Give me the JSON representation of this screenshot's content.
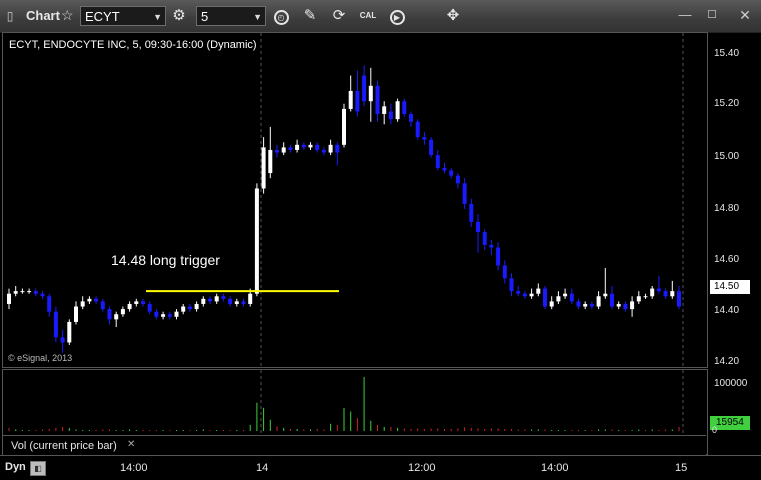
{
  "toolbar": {
    "app_title": "Chart",
    "symbol": "ECYT",
    "interval": "5",
    "calendar_icon_text": "CAL"
  },
  "chart": {
    "title": "ECYT, ENDOCYTE INC, 5, 09:30-16:00 (Dynamic)",
    "annotation": "14.48 long trigger",
    "copyright": "© eSignal, 2013",
    "last_price_label": "14.50",
    "colors": {
      "up": "#ffffff",
      "down": "#1a1aff",
      "trigger": "#ffff00",
      "vol_up": "#3fcf3f",
      "vol_down": "#cc2222"
    }
  },
  "price_axis": {
    "ticks": [
      "15.40",
      "15.20",
      "15.00",
      "14.80",
      "14.60",
      "14.40",
      "14.20"
    ]
  },
  "volume": {
    "label": "Vol (current price bar)",
    "tick": "100000",
    "zero": "0",
    "last_value": "15954"
  },
  "time_axis": {
    "labels": [
      "14:00",
      "14",
      "12:00",
      "14:00",
      "15"
    ],
    "mode": "Dyn"
  },
  "chart_data": {
    "type": "candlestick",
    "title": "ECYT, ENDOCYTE INC, 5, 09:30-16:00 (Dynamic)",
    "y_axis_ticks": [
      15.4,
      15.2,
      15.0,
      14.8,
      14.6,
      14.4,
      14.2
    ],
    "ylim": [
      14.18,
      15.48
    ],
    "trigger_level": 14.48,
    "annotation": "14.48 long trigger",
    "last_price": 14.5,
    "x_labels": [
      "14:00",
      "14",
      "12:00",
      "14:00",
      "15"
    ],
    "candles": [
      [
        14.43,
        14.47,
        14.49,
        14.41
      ],
      [
        14.47,
        14.48,
        14.5,
        14.46
      ],
      [
        14.48,
        14.48,
        14.49,
        14.47
      ],
      [
        14.48,
        14.48,
        14.49,
        14.47
      ],
      [
        14.48,
        14.47,
        14.49,
        14.46
      ],
      [
        14.47,
        14.46,
        14.48,
        14.45
      ],
      [
        14.46,
        14.4,
        14.47,
        14.38
      ],
      [
        14.4,
        14.3,
        14.42,
        14.28
      ],
      [
        14.3,
        14.28,
        14.33,
        14.24
      ],
      [
        14.28,
        14.36,
        14.37,
        14.27
      ],
      [
        14.36,
        14.42,
        14.44,
        14.35
      ],
      [
        14.42,
        14.44,
        14.46,
        14.41
      ],
      [
        14.44,
        14.45,
        14.46,
        14.43
      ],
      [
        14.45,
        14.44,
        14.46,
        14.43
      ],
      [
        14.44,
        14.41,
        14.45,
        14.4
      ],
      [
        14.41,
        14.37,
        14.42,
        14.35
      ],
      [
        14.37,
        14.39,
        14.4,
        14.34
      ],
      [
        14.39,
        14.41,
        14.42,
        14.38
      ],
      [
        14.41,
        14.43,
        14.44,
        14.4
      ],
      [
        14.43,
        14.44,
        14.45,
        14.42
      ],
      [
        14.44,
        14.43,
        14.45,
        14.42
      ],
      [
        14.43,
        14.4,
        14.44,
        14.39
      ],
      [
        14.4,
        14.38,
        14.41,
        14.37
      ],
      [
        14.38,
        14.39,
        14.4,
        14.37
      ],
      [
        14.39,
        14.38,
        14.4,
        14.37
      ],
      [
        14.38,
        14.4,
        14.41,
        14.37
      ],
      [
        14.4,
        14.42,
        14.43,
        14.39
      ],
      [
        14.42,
        14.41,
        14.43,
        14.4
      ],
      [
        14.41,
        14.43,
        14.44,
        14.4
      ],
      [
        14.43,
        14.45,
        14.46,
        14.42
      ],
      [
        14.45,
        14.44,
        14.46,
        14.43
      ],
      [
        14.44,
        14.46,
        14.47,
        14.43
      ],
      [
        14.46,
        14.45,
        14.47,
        14.44
      ],
      [
        14.45,
        14.43,
        14.46,
        14.42
      ],
      [
        14.43,
        14.44,
        14.45,
        14.42
      ],
      [
        14.44,
        14.43,
        14.45,
        14.42
      ],
      [
        14.43,
        14.47,
        14.49,
        14.42
      ],
      [
        14.47,
        14.88,
        14.9,
        14.46
      ],
      [
        14.88,
        15.04,
        15.08,
        14.86
      ],
      [
        14.94,
        15.03,
        15.12,
        14.92
      ],
      [
        15.03,
        15.02,
        15.05,
        15.0
      ],
      [
        15.02,
        15.04,
        15.06,
        15.01
      ],
      [
        15.04,
        15.03,
        15.05,
        15.02
      ],
      [
        15.03,
        15.05,
        15.07,
        15.02
      ],
      [
        15.05,
        15.04,
        15.06,
        15.03
      ],
      [
        15.04,
        15.05,
        15.06,
        15.03
      ],
      [
        15.05,
        15.03,
        15.06,
        15.02
      ],
      [
        15.03,
        15.02,
        15.04,
        15.01
      ],
      [
        15.02,
        15.05,
        15.07,
        15.01
      ],
      [
        15.05,
        15.02,
        15.06,
        14.97
      ],
      [
        15.05,
        15.19,
        15.21,
        15.04
      ],
      [
        15.19,
        15.26,
        15.32,
        15.18
      ],
      [
        15.26,
        15.18,
        15.34,
        15.16
      ],
      [
        15.32,
        15.22,
        15.36,
        15.2
      ],
      [
        15.22,
        15.28,
        15.35,
        15.14
      ],
      [
        15.28,
        15.17,
        15.3,
        15.14
      ],
      [
        15.17,
        15.2,
        15.22,
        15.13
      ],
      [
        15.18,
        15.15,
        15.21,
        15.13
      ],
      [
        15.15,
        15.22,
        15.23,
        15.14
      ],
      [
        15.22,
        15.17,
        15.23,
        15.16
      ],
      [
        15.17,
        15.14,
        15.18,
        15.12
      ],
      [
        15.14,
        15.08,
        15.15,
        15.07
      ],
      [
        15.08,
        15.07,
        15.1,
        15.05
      ],
      [
        15.07,
        15.01,
        15.08,
        15.0
      ],
      [
        15.01,
        14.96,
        15.03,
        14.95
      ],
      [
        14.96,
        14.95,
        14.98,
        14.94
      ],
      [
        14.95,
        14.93,
        14.96,
        14.92
      ],
      [
        14.93,
        14.9,
        14.94,
        14.88
      ],
      [
        14.9,
        14.82,
        14.92,
        14.8
      ],
      [
        14.82,
        14.75,
        14.84,
        14.73
      ],
      [
        14.75,
        14.71,
        14.78,
        14.63
      ],
      [
        14.71,
        14.66,
        14.72,
        14.64
      ],
      [
        14.66,
        14.65,
        14.68,
        14.62
      ],
      [
        14.65,
        14.58,
        14.67,
        14.56
      ],
      [
        14.58,
        14.53,
        14.6,
        14.51
      ],
      [
        14.53,
        14.48,
        14.55,
        14.46
      ],
      [
        14.48,
        14.47,
        14.5,
        14.46
      ],
      [
        14.47,
        14.46,
        14.48,
        14.45
      ],
      [
        14.46,
        14.47,
        14.49,
        14.45
      ],
      [
        14.47,
        14.49,
        14.51,
        14.46
      ],
      [
        14.49,
        14.42,
        14.5,
        14.41
      ],
      [
        14.42,
        14.44,
        14.46,
        14.41
      ],
      [
        14.44,
        14.46,
        14.48,
        14.43
      ],
      [
        14.46,
        14.47,
        14.49,
        14.45
      ],
      [
        14.47,
        14.44,
        14.49,
        14.43
      ],
      [
        14.44,
        14.42,
        14.45,
        14.41
      ],
      [
        14.42,
        14.43,
        14.44,
        14.41
      ],
      [
        14.43,
        14.42,
        14.44,
        14.41
      ],
      [
        14.42,
        14.46,
        14.48,
        14.41
      ],
      [
        14.46,
        14.47,
        14.57,
        14.45
      ],
      [
        14.47,
        14.42,
        14.5,
        14.41
      ],
      [
        14.42,
        14.43,
        14.44,
        14.41
      ],
      [
        14.43,
        14.41,
        14.44,
        14.4
      ],
      [
        14.41,
        14.44,
        14.46,
        14.38
      ],
      [
        14.44,
        14.46,
        14.48,
        14.43
      ],
      [
        14.46,
        14.46,
        14.47,
        14.45
      ],
      [
        14.46,
        14.49,
        14.5,
        14.45
      ],
      [
        14.49,
        14.48,
        14.54,
        14.47
      ],
      [
        14.48,
        14.46,
        14.49,
        14.45
      ],
      [
        14.46,
        14.48,
        14.52,
        14.45
      ],
      [
        14.48,
        14.42,
        14.5,
        14.41
      ]
    ],
    "volume_ticks": [
      100000,
      0
    ],
    "volume_last": 15954,
    "volumes": [
      [
        1,
        6000
      ],
      [
        0,
        3000
      ],
      [
        0,
        2000
      ],
      [
        0,
        2000
      ],
      [
        1,
        2000
      ],
      [
        1,
        3000
      ],
      [
        1,
        4000
      ],
      [
        1,
        6000
      ],
      [
        1,
        8000
      ],
      [
        0,
        6000
      ],
      [
        0,
        3000
      ],
      [
        0,
        2000
      ],
      [
        0,
        2000
      ],
      [
        1,
        2000
      ],
      [
        1,
        3000
      ],
      [
        1,
        3000
      ],
      [
        0,
        2000
      ],
      [
        0,
        2000
      ],
      [
        0,
        3000
      ],
      [
        0,
        2000
      ],
      [
        1,
        2000
      ],
      [
        1,
        2000
      ],
      [
        1,
        2000
      ],
      [
        0,
        2000
      ],
      [
        1,
        1500
      ],
      [
        0,
        2000
      ],
      [
        0,
        2000
      ],
      [
        1,
        1500
      ],
      [
        0,
        2000
      ],
      [
        0,
        3000
      ],
      [
        1,
        2000
      ],
      [
        0,
        2000
      ],
      [
        1,
        2000
      ],
      [
        1,
        2000
      ],
      [
        0,
        2000
      ],
      [
        1,
        2000
      ],
      [
        0,
        12000
      ],
      [
        0,
        55000
      ],
      [
        0,
        45000
      ],
      [
        0,
        22000
      ],
      [
        1,
        9000
      ],
      [
        0,
        6000
      ],
      [
        1,
        4000
      ],
      [
        0,
        4000
      ],
      [
        1,
        3000
      ],
      [
        0,
        3000
      ],
      [
        1,
        4000
      ],
      [
        1,
        3000
      ],
      [
        0,
        14000
      ],
      [
        1,
        12000
      ],
      [
        0,
        45000
      ],
      [
        0,
        38000
      ],
      [
        1,
        25000
      ],
      [
        0,
        105000
      ],
      [
        0,
        20000
      ],
      [
        1,
        12000
      ],
      [
        0,
        8000
      ],
      [
        1,
        8000
      ],
      [
        0,
        6000
      ],
      [
        1,
        5000
      ],
      [
        1,
        4000
      ],
      [
        1,
        5000
      ],
      [
        1,
        4000
      ],
      [
        1,
        5000
      ],
      [
        1,
        5000
      ],
      [
        1,
        4000
      ],
      [
        1,
        4000
      ],
      [
        1,
        5000
      ],
      [
        1,
        7000
      ],
      [
        1,
        6000
      ],
      [
        1,
        5000
      ],
      [
        1,
        4000
      ],
      [
        1,
        5000
      ],
      [
        1,
        5000
      ],
      [
        1,
        4000
      ],
      [
        1,
        4000
      ],
      [
        1,
        3000
      ],
      [
        1,
        3000
      ],
      [
        0,
        3000
      ],
      [
        0,
        3000
      ],
      [
        1,
        3000
      ],
      [
        0,
        2000
      ],
      [
        0,
        2000
      ],
      [
        0,
        2000
      ],
      [
        1,
        2000
      ],
      [
        1,
        2000
      ],
      [
        0,
        2000
      ],
      [
        1,
        2000
      ],
      [
        0,
        3000
      ],
      [
        0,
        3000
      ],
      [
        1,
        3000
      ],
      [
        0,
        2000
      ],
      [
        1,
        2000
      ],
      [
        0,
        2000
      ],
      [
        0,
        3000
      ],
      [
        1,
        2000
      ],
      [
        0,
        3000
      ],
      [
        1,
        2000
      ],
      [
        1,
        3000
      ],
      [
        0,
        3000
      ],
      [
        1,
        8000
      ]
    ]
  }
}
